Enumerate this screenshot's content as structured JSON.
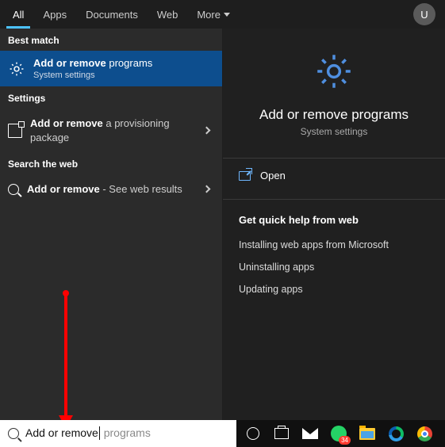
{
  "tabs": {
    "all": "All",
    "apps": "Apps",
    "documents": "Documents",
    "web": "Web",
    "more": "More"
  },
  "avatar_initial": "U",
  "left": {
    "best_match_label": "Best match",
    "best_match": {
      "title_bold": "Add or remove",
      "title_rest": " programs",
      "subtitle": "System settings"
    },
    "settings_label": "Settings",
    "settings_item": {
      "bold": "Add or remove",
      "rest": " a provisioning package"
    },
    "web_label": "Search the web",
    "web_item": {
      "bold": "Add or remove",
      "rest": " - See web results"
    }
  },
  "right": {
    "title": "Add or remove programs",
    "subtitle": "System settings",
    "open": "Open",
    "help_header": "Get quick help from web",
    "links": {
      "l1": "Installing web apps from Microsoft",
      "l2": "Uninstalling apps",
      "l3": "Updating apps"
    }
  },
  "search": {
    "typed": "Add or remove",
    "hint": " programs"
  },
  "whatsapp_badge": "34",
  "colors": {
    "accent": "#4cc2ff",
    "selection": "#0d4e8e"
  }
}
